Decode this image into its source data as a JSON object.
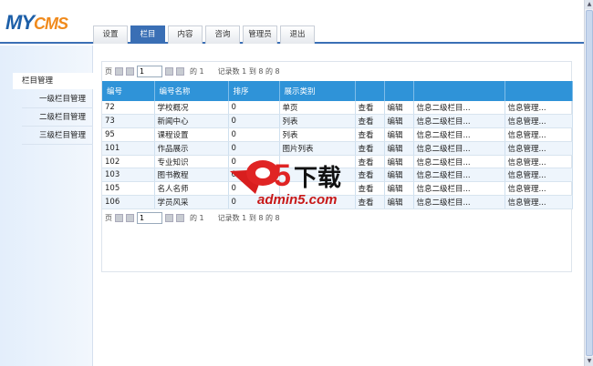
{
  "logo": {
    "my": "MY",
    "cms": "CMS"
  },
  "tabs": [
    {
      "label": "设置"
    },
    {
      "label": "栏目",
      "active": true
    },
    {
      "label": "内容"
    },
    {
      "label": "咨询"
    },
    {
      "label": "管理员"
    },
    {
      "label": "退出"
    }
  ],
  "sidebar": {
    "header": "栏目管理",
    "items": [
      {
        "label": "一级栏目管理"
      },
      {
        "label": "二级栏目管理"
      },
      {
        "label": "三级栏目管理"
      }
    ]
  },
  "pager": {
    "page_label": "页",
    "page_value": "1",
    "of_label": "的 1",
    "records": "记录数 1 到 8 的 8"
  },
  "table": {
    "headers": [
      "编号",
      "编号名称",
      "排序",
      "展示类别",
      "",
      "",
      "",
      ""
    ],
    "rows": [
      [
        "72",
        "学校概况",
        "0",
        "单页",
        "查看",
        "编辑",
        "信息二级栏目...",
        "信息管理..."
      ],
      [
        "73",
        "新闻中心",
        "0",
        "列表",
        "查看",
        "编辑",
        "信息二级栏目...",
        "信息管理..."
      ],
      [
        "95",
        "课程设置",
        "0",
        "列表",
        "查看",
        "编辑",
        "信息二级栏目...",
        "信息管理..."
      ],
      [
        "101",
        "作品展示",
        "0",
        "图片列表",
        "查看",
        "编辑",
        "信息二级栏目...",
        "信息管理..."
      ],
      [
        "102",
        "专业知识",
        "0",
        "",
        "查看",
        "编辑",
        "信息二级栏目...",
        "信息管理..."
      ],
      [
        "103",
        "图书教程",
        "0",
        "",
        "查看",
        "编辑",
        "信息二级栏目...",
        "信息管理..."
      ],
      [
        "105",
        "名人名师",
        "0",
        "",
        "查看",
        "编辑",
        "信息二级栏目...",
        "信息管理..."
      ],
      [
        "106",
        "学员风采",
        "0",
        "",
        "查看",
        "编辑",
        "信息二级栏目...",
        "信息管理..."
      ]
    ]
  },
  "watermark": {
    "brand": "a5下载",
    "url": "admin5.com"
  },
  "colors": {
    "accent": "#3a6fb5",
    "table_header": "#2f93d8",
    "logo_blue": "#1d5fa8",
    "logo_orange": "#f08a1c"
  }
}
